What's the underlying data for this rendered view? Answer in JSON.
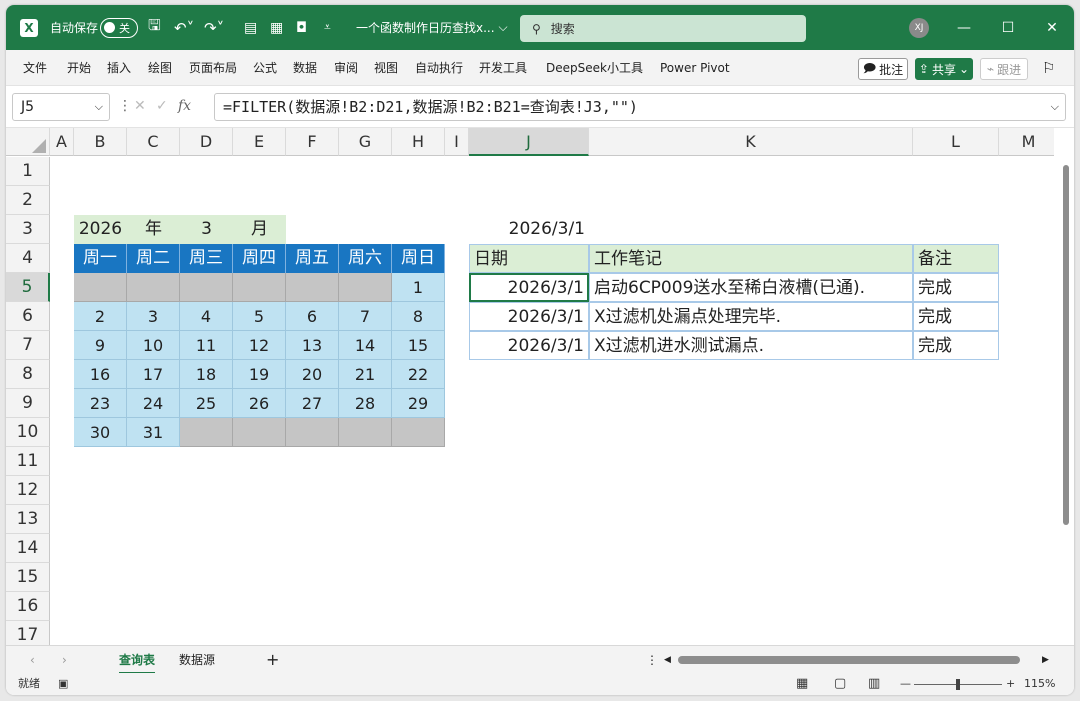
{
  "window": {
    "autosave_label": "自动保存",
    "autosave_state": "关",
    "doc_title": "一个函数制作日历查找x...",
    "search_placeholder": "搜索",
    "avatar": "XJ"
  },
  "menu": {
    "items": [
      "文件",
      "开始",
      "插入",
      "绘图",
      "页面布局",
      "公式",
      "数据",
      "审阅",
      "视图",
      "自动执行",
      "开发工具",
      "DeepSeek小工具",
      "Power Pivot"
    ],
    "comment_btn": "批注",
    "share_btn": "共享",
    "follow_btn": "跟进"
  },
  "formula": {
    "name_box": "J5",
    "text": "=FILTER(数据源!B2:D21,数据源!B2:B21=查询表!J3,\"\")"
  },
  "columns": [
    "A",
    "B",
    "C",
    "D",
    "E",
    "F",
    "G",
    "H",
    "I",
    "J",
    "K",
    "L",
    "M"
  ],
  "rows": [
    "1",
    "2",
    "3",
    "4",
    "5",
    "6",
    "7",
    "8",
    "9",
    "10",
    "11",
    "12",
    "13",
    "14",
    "15",
    "16",
    "17"
  ],
  "calendar": {
    "year": "2026",
    "year_unit": "年",
    "month": "3",
    "month_unit": "月",
    "weekdays": [
      "周一",
      "周二",
      "周三",
      "周四",
      "周五",
      "周六",
      "周日"
    ],
    "weeks": [
      [
        "",
        "",
        "",
        "",
        "",
        "",
        "1"
      ],
      [
        "2",
        "3",
        "4",
        "5",
        "6",
        "7",
        "8"
      ],
      [
        "9",
        "10",
        "11",
        "12",
        "13",
        "14",
        "15"
      ],
      [
        "16",
        "17",
        "18",
        "19",
        "20",
        "21",
        "22"
      ],
      [
        "23",
        "24",
        "25",
        "26",
        "27",
        "28",
        "29"
      ],
      [
        "30",
        "31",
        "",
        "",
        "",
        "",
        ""
      ]
    ]
  },
  "query": {
    "date": "2026/3/1",
    "headers": [
      "日期",
      "工作笔记",
      "备注"
    ],
    "rows": [
      [
        "2026/3/1",
        "启动6CP009送水至稀白液槽(已通).",
        "完成"
      ],
      [
        "2026/3/1",
        "X过滤机处漏点处理完毕.",
        "完成"
      ],
      [
        "2026/3/1",
        "X过滤机进水测试漏点.",
        "完成"
      ]
    ]
  },
  "tabs": {
    "sheet1": "查询表",
    "sheet2": "数据源",
    "add": "+"
  },
  "status": {
    "ready": "就绪",
    "zoom": "115%"
  },
  "colors": {
    "accent": "#1f7a47",
    "header_blue": "#1976c2",
    "day_blue": "#bfe2f2",
    "light_green": "#dbeed5"
  }
}
